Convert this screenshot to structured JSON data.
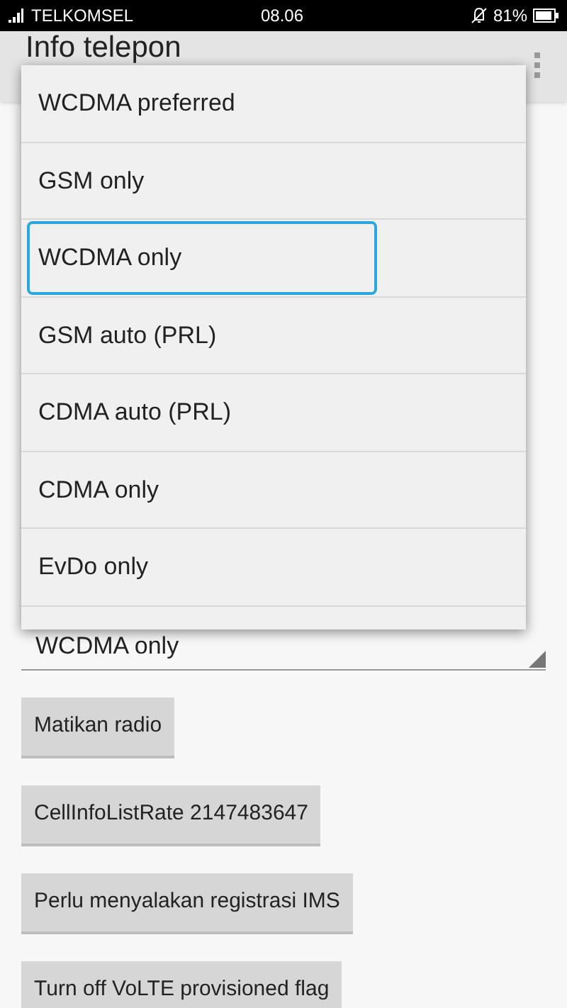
{
  "status_bar": {
    "carrier": "TELKOMSEL",
    "time": "08.06",
    "battery": "81%"
  },
  "app_bar": {
    "title": "Info telepon"
  },
  "menu": {
    "options": [
      {
        "label": "WCDMA preferred",
        "selected": false
      },
      {
        "label": "GSM only",
        "selected": false
      },
      {
        "label": "WCDMA only",
        "selected": true
      },
      {
        "label": "GSM auto (PRL)",
        "selected": false
      },
      {
        "label": "CDMA auto (PRL)",
        "selected": false
      },
      {
        "label": "CDMA only",
        "selected": false
      },
      {
        "label": "EvDo only",
        "selected": false
      }
    ]
  },
  "spinner": {
    "value": "WCDMA only"
  },
  "buttons": [
    "Matikan radio",
    "CellInfoListRate 2147483647",
    "Perlu menyalakan registrasi IMS",
    "Turn off VoLTE provisioned flag"
  ]
}
